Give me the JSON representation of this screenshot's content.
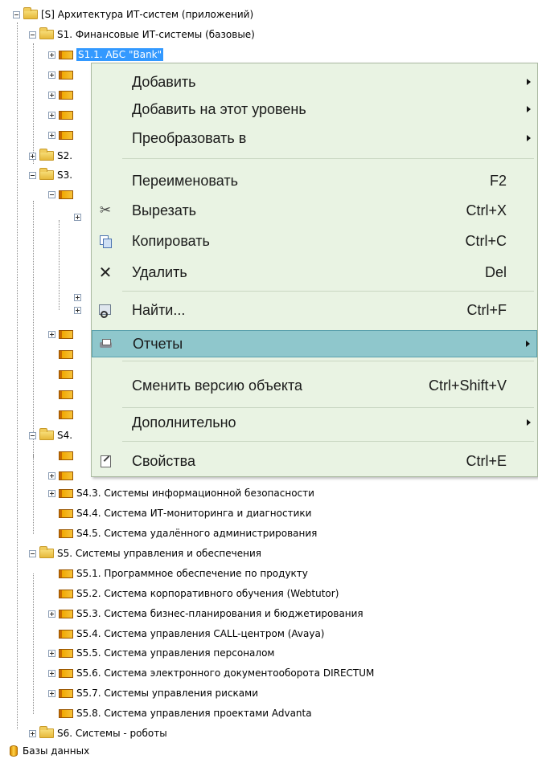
{
  "tree": {
    "root_label": "[S] Архитектура ИТ-систем (приложений)",
    "s1_label": "S1. Финансовые ИТ-системы (базовые)",
    "s1_1_label": "S1.1. АБС \"Bank\"",
    "s2_label": "S2.",
    "s3_label": "S3.",
    "s4_label": "S4.",
    "s4_3_label": "S4.3. Системы информационной безопасности",
    "s4_4_label": "S4.4. Система ИТ-мониторинга и диагностики",
    "s4_5_label": "S4.5. Система удалённого администрирования",
    "s5_label": "S5. Системы управления и обеспечения",
    "s5_items": [
      "S5.1. Программное обеспечение по продукту",
      "S5.2. Система корпоративного обучения (Webtutor)",
      "S5.3. Система бизнес-планирования и бюджетирования",
      "S5.4. Система управления CALL-центром (Avaya)",
      "S5.5. Система управления персоналом",
      "S5.6. Система электронного документооборота DIRECTUM",
      "S5.7. Системы управления рисками",
      "S5.8. Система управления проектами Advanta"
    ],
    "s6_label": "S6. Системы - роботы",
    "db_label": "Базы данных"
  },
  "menu": {
    "add": "Добавить",
    "add_level": "Добавить на этот уровень",
    "convert": "Преобразовать в",
    "rename": "Переименовать",
    "rename_sc": "F2",
    "cut": "Вырезать",
    "cut_sc": "Ctrl+X",
    "copy": "Копировать",
    "copy_sc": "Ctrl+C",
    "delete": "Удалить",
    "delete_sc": "Del",
    "find": "Найти...",
    "find_sc": "Ctrl+F",
    "reports": "Отчеты",
    "change_version": "Сменить версию объекта",
    "change_version_sc": "Ctrl+Shift+V",
    "additional": "Дополнительно",
    "properties": "Свойства",
    "properties_sc": "Ctrl+E"
  },
  "icons": {
    "cut": "scissors-icon",
    "copy": "copy-icon",
    "delete": "delete-x-icon",
    "find": "find-icon",
    "reports": "printer-icon",
    "properties": "properties-icon"
  },
  "colors": {
    "selection": "#3399ff",
    "menu_bg": "#e9f3e3",
    "menu_highlight": "#8fc7cc"
  }
}
